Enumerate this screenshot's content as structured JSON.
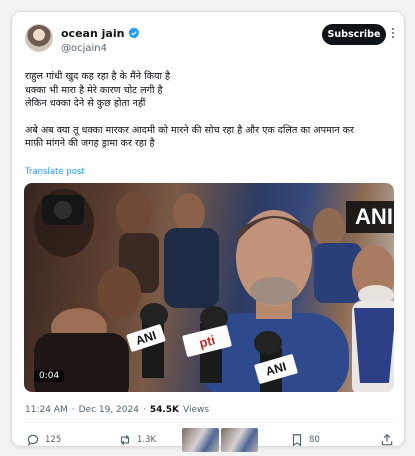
{
  "tweet": {
    "author": {
      "name": "ocean jain",
      "handle": "@ocjain4",
      "verified": true
    },
    "subscribe_label": "Subscribe",
    "text_lines": [
      "राहुल गांधी खुद कह रहा है के मैंने किया है",
      "धक्का भी मारा है मेरे कारण चोट लगी है",
      "लेकिन धक्का देने से कुछ होता नहीं",
      "अबे अब क्या तू धक्का मारकर आदमी को मारने की सोच रहा है और एक दलित का अपमान कर",
      "माफ़ी मांगने की जगह ड्रामा कर रहा है"
    ],
    "translate_label": "Translate post",
    "media": {
      "ani_watermark": "ANI",
      "mic_labels": [
        "ANI",
        "pti",
        "ANI"
      ],
      "duration": "0:04"
    },
    "meta": {
      "time": "11:24 AM",
      "separator": "·",
      "date": "Dec 19, 2024",
      "separator2": "·",
      "views_count": "54.5K",
      "views_label": "Views"
    },
    "actions": {
      "replies": "125",
      "reposts": "1.3K",
      "bookmarks": "80"
    }
  },
  "colors": {
    "accent": "#1d9bf0",
    "verified": "#1d9bf0",
    "subscribe_bg": "#0f1419"
  }
}
